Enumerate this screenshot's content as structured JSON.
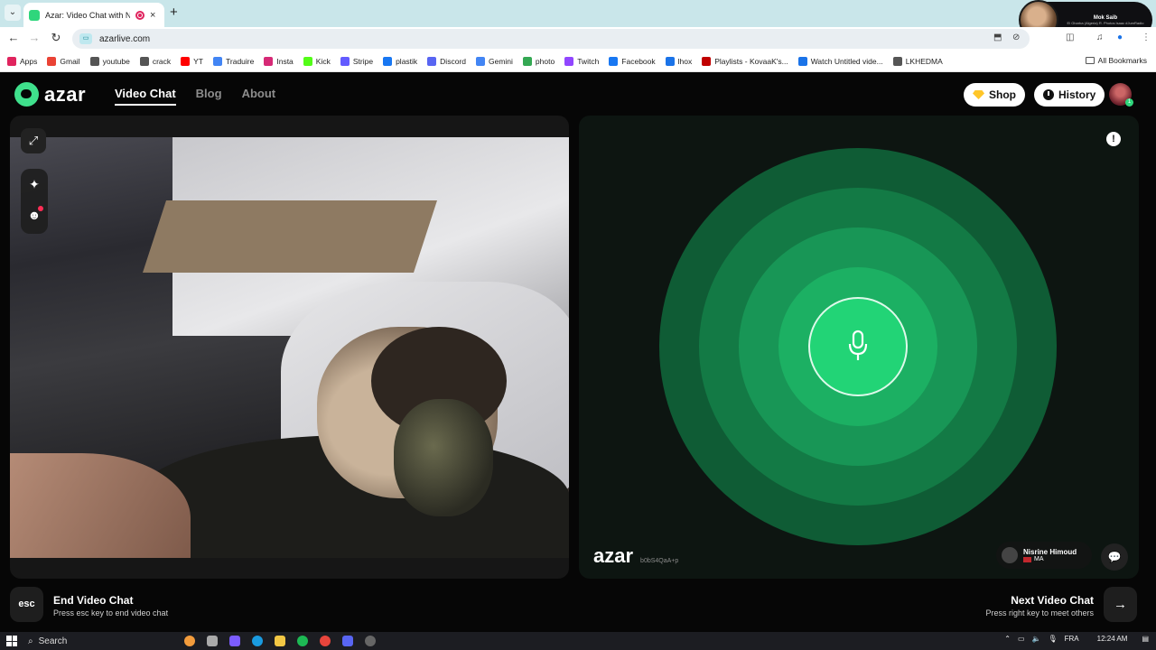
{
  "browser": {
    "tab_title": "Azar: Video Chat with New",
    "tab_close": "×",
    "new_tab": "+",
    "url": "azarlive.com",
    "profile_name": "Mok Saib",
    "profile_sub": "El Gharba (Algeria) R. Photos Isaac #JumRadio",
    "bookmarks": [
      {
        "label": "Apps",
        "color": "#e0245e"
      },
      {
        "label": "Gmail",
        "color": "#ea4335"
      },
      {
        "label": "youtube",
        "color": "#555555"
      },
      {
        "label": "crack",
        "color": "#555555"
      },
      {
        "label": "YT",
        "color": "#ff0000"
      },
      {
        "label": "Traduire",
        "color": "#4285f4"
      },
      {
        "label": "Insta",
        "color": "#d62976"
      },
      {
        "label": "Kick",
        "color": "#53fc18"
      },
      {
        "label": "Stripe",
        "color": "#635bff"
      },
      {
        "label": "plastik",
        "color": "#1877f2"
      },
      {
        "label": "Discord",
        "color": "#5865f2"
      },
      {
        "label": "Gemini",
        "color": "#4285f4"
      },
      {
        "label": "photo",
        "color": "#34a853"
      },
      {
        "label": "Twitch",
        "color": "#9146ff"
      },
      {
        "label": "Facebook",
        "color": "#1877f2"
      },
      {
        "label": "lhox",
        "color": "#1a73e8"
      },
      {
        "label": "Playlists - KovaaK's...",
        "color": "#c00000"
      },
      {
        "label": "Watch Untitled vide...",
        "color": "#1a73e8"
      },
      {
        "label": "LKHEDMA",
        "color": "#555555"
      }
    ],
    "all_bookmarks": "All Bookmarks"
  },
  "azar": {
    "brand": "azar",
    "nav": [
      {
        "label": "Video Chat",
        "active": true
      },
      {
        "label": "Blog",
        "active": false
      },
      {
        "label": "About",
        "active": false
      }
    ],
    "shop_label": "Shop",
    "history_label": "History",
    "avatar_badge": "1",
    "watermark_brand": "azar",
    "watermark_code": "b0bS4QaA+p",
    "partner_name": "Nisrine Himoud",
    "partner_country": "MA",
    "esc_key": "esc",
    "end_title": "End Video Chat",
    "end_sub": "Press esc key to end video chat",
    "next_title": "Next Video Chat",
    "next_sub": "Press right key to meet others",
    "accent": "#22d476"
  },
  "taskbar": {
    "search_placeholder": "Search",
    "language": "FRA",
    "time": "12:24 AM"
  }
}
